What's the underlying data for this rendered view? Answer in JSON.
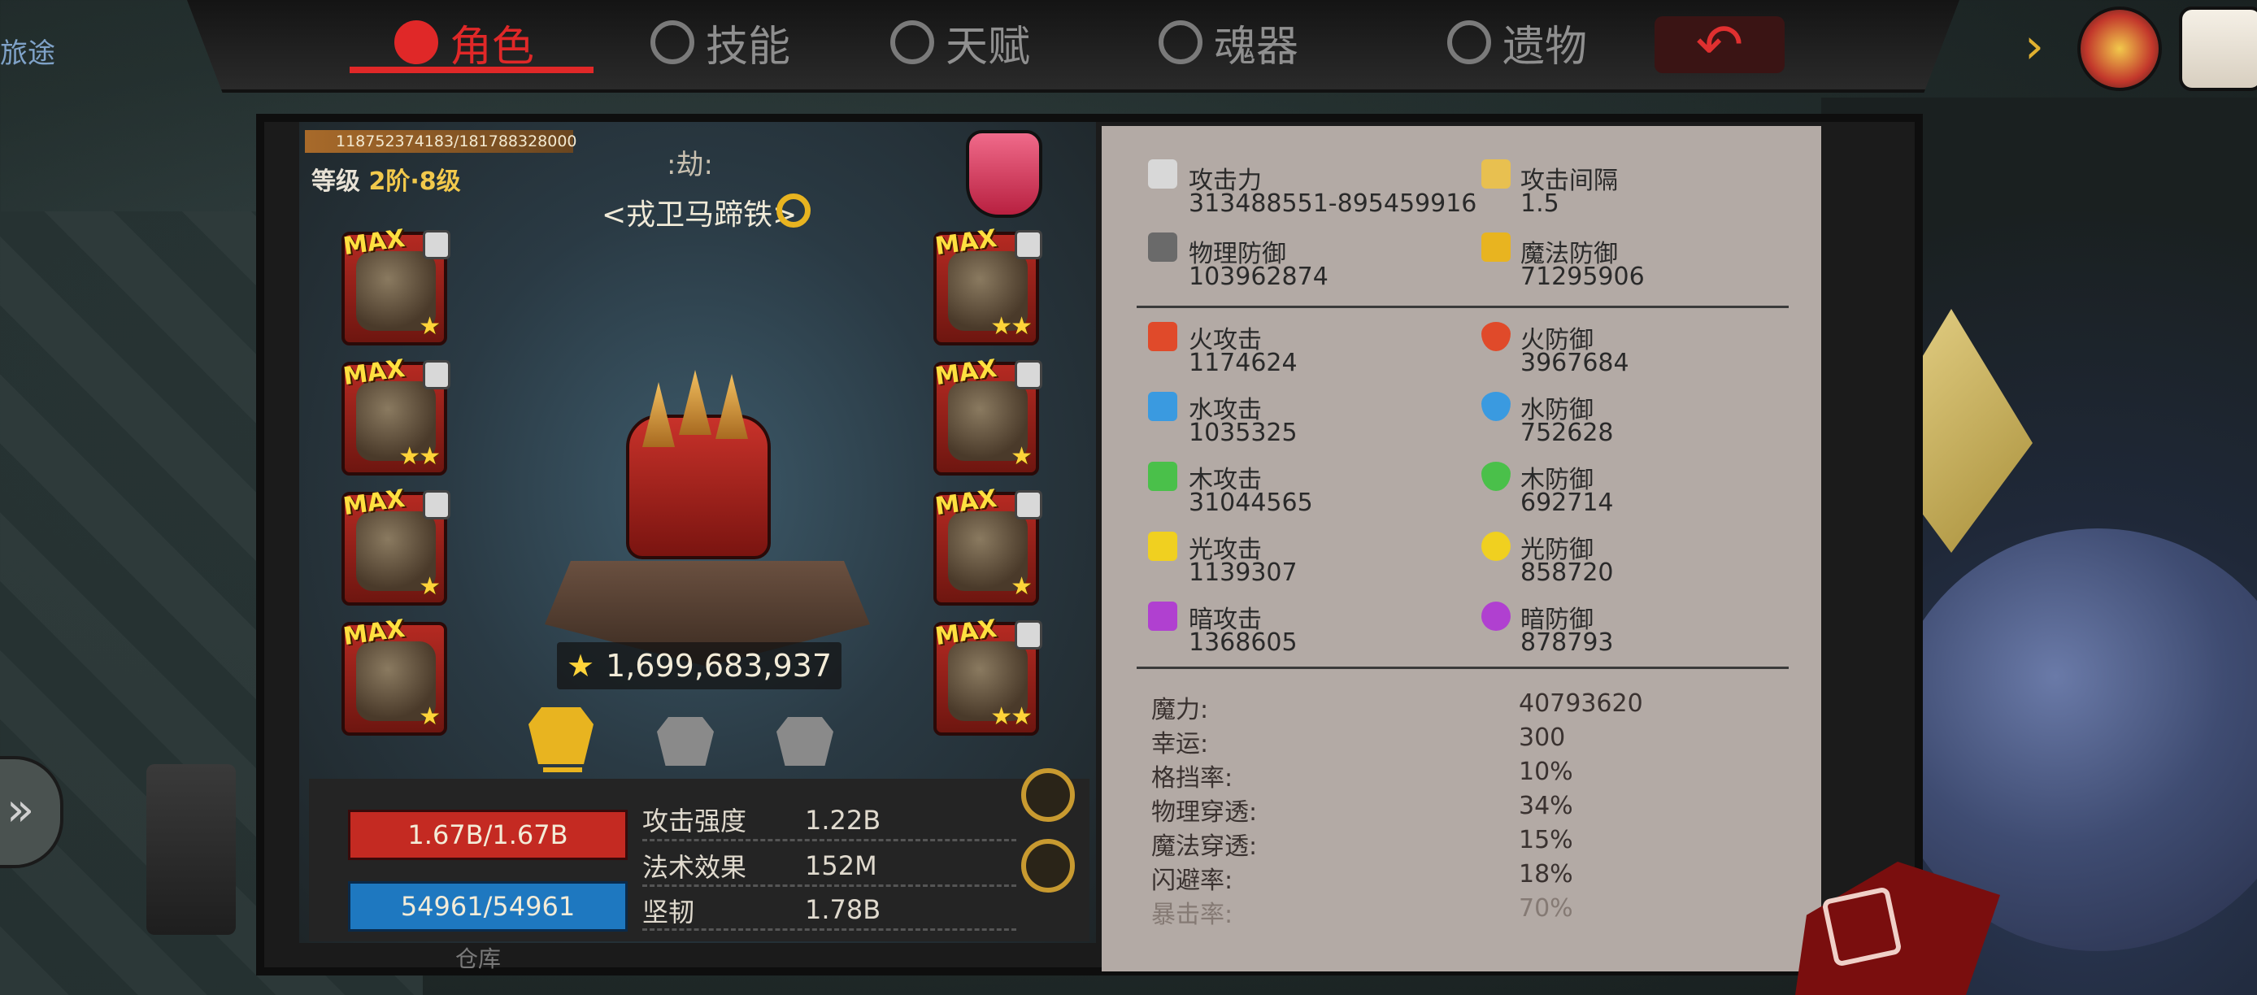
{
  "top_tabs": [
    {
      "label": "角色",
      "icon": "demon-icon",
      "active": true
    },
    {
      "label": "技能",
      "icon": "skill-icon",
      "active": false
    },
    {
      "label": "天赋",
      "icon": "talent-icon",
      "active": false
    },
    {
      "label": "魂器",
      "icon": "soul-vessel-icon",
      "active": false
    },
    {
      "label": "遗物",
      "icon": "relic-icon",
      "active": false
    }
  ],
  "corner_label": "旅途",
  "exp_text": "118752374183/181788328000",
  "level": {
    "prefix": "等级",
    "value": "2阶·8级"
  },
  "hero": {
    "title": ":劫:",
    "name": "<戎卫马蹄铁>"
  },
  "equipment_left": [
    {
      "badge": "MAX",
      "stars": "★"
    },
    {
      "badge": "MAX",
      "stars": "★★"
    },
    {
      "badge": "MAX",
      "stars": "★"
    },
    {
      "badge": "MAX",
      "stars": "★"
    }
  ],
  "equipment_right": [
    {
      "badge": "MAX",
      "stars": "★★"
    },
    {
      "badge": "MAX",
      "stars": "★"
    },
    {
      "badge": "MAX",
      "stars": "★"
    },
    {
      "badge": "MAX",
      "stars": "★★"
    }
  ],
  "combat_power": "1,699,683,937",
  "hp": "1.67B/1.67B",
  "mp": "54961/54961",
  "bottom_stats": [
    {
      "label": "攻击强度",
      "value": "1.22B"
    },
    {
      "label": "法术效果",
      "value": "152M"
    },
    {
      "label": "坚韧",
      "value": "1.78B"
    }
  ],
  "storage_label": "仓库",
  "main_stats": [
    {
      "name": "攻击力",
      "value": "313488551-895459916",
      "icon": "sword-icon",
      "color": "#d8d8d8"
    },
    {
      "name": "攻击间隔",
      "value": "1.5",
      "icon": "golden-sword-icon",
      "color": "#e8c050"
    },
    {
      "name": "物理防御",
      "value": "103962874",
      "icon": "shield-sword-icon",
      "color": "#6a6a6a"
    },
    {
      "name": "魔法防御",
      "value": "71295906",
      "icon": "magic-defense-icon",
      "color": "#e8b420"
    }
  ],
  "element_stats": [
    {
      "atk_name": "火攻击",
      "atk_value": "1174624",
      "def_name": "火防御",
      "def_value": "3967684",
      "color": "#e04a2a"
    },
    {
      "atk_name": "水攻击",
      "atk_value": "1035325",
      "def_name": "水防御",
      "def_value": "752628",
      "color": "#3a9ae0"
    },
    {
      "atk_name": "木攻击",
      "atk_value": "31044565",
      "def_name": "木防御",
      "def_value": "692714",
      "color": "#4ac04a"
    },
    {
      "atk_name": "光攻击",
      "atk_value": "1139307",
      "def_name": "光防御",
      "def_value": "858720",
      "color": "#f0d020"
    },
    {
      "atk_name": "暗攻击",
      "atk_value": "1368605",
      "def_name": "暗防御",
      "def_value": "878793",
      "color": "#b040d0"
    }
  ],
  "misc_stats": [
    {
      "name": "魔力:",
      "value": "40793620"
    },
    {
      "name": "幸运:",
      "value": "300"
    },
    {
      "name": "格挡率:",
      "value": "10%"
    },
    {
      "name": "物理穿透:",
      "value": "34%"
    },
    {
      "name": "魔法穿透:",
      "value": "15%"
    },
    {
      "name": "闪避率:",
      "value": "18%"
    },
    {
      "name": "暴击率:",
      "value": "70%"
    }
  ],
  "colors": {
    "accent_red": "#e02828",
    "gold": "#e8b420",
    "hp_red": "#c42a22",
    "mp_blue": "#1e78c0",
    "panel": "#b3aaa5"
  }
}
